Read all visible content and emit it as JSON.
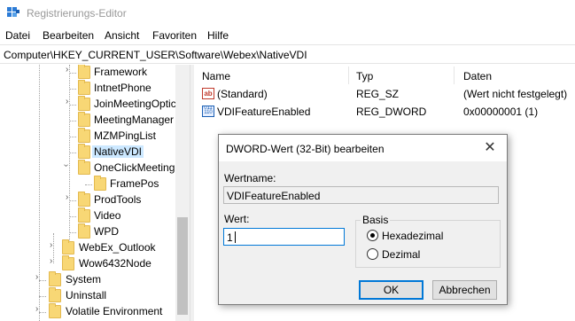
{
  "window": {
    "title": "Registrierungs-Editor"
  },
  "menu": [
    "Datei",
    "Bearbeiten",
    "Ansicht",
    "Favoriten",
    "Hilfe"
  ],
  "address": "Computer\\HKEY_CURRENT_USER\\Software\\Webex\\NativeVDI",
  "tree": {
    "items": [
      {
        "label": "Framework"
      },
      {
        "label": "IntnetPhone"
      },
      {
        "label": "JoinMeetingOptic"
      },
      {
        "label": "MeetingManager"
      },
      {
        "label": "MZMPingList"
      },
      {
        "label": "NativeVDI"
      },
      {
        "label": "OneClickMeeting"
      },
      {
        "label": "FramePos"
      },
      {
        "label": "ProdTools"
      },
      {
        "label": "Video"
      },
      {
        "label": "WPD"
      },
      {
        "label": "WebEx_Outlook"
      },
      {
        "label": "Wow6432Node"
      },
      {
        "label": "System"
      },
      {
        "label": "Uninstall"
      },
      {
        "label": "Volatile Environment"
      }
    ]
  },
  "list": {
    "columns": [
      "Name",
      "Typ",
      "Daten"
    ],
    "rows": [
      {
        "icon": "ab-string-icon",
        "name": "(Standard)",
        "type": "REG_SZ",
        "data": "(Wert nicht festgelegt)"
      },
      {
        "icon": "binary-dword-icon",
        "name": "VDIFeatureEnabled",
        "type": "REG_DWORD",
        "data": "0x00000001 (1)"
      }
    ]
  },
  "dialog": {
    "title": "DWORD-Wert (32-Bit) bearbeiten",
    "close_glyph": "✕",
    "name_label": "Wertname:",
    "name_value": "VDIFeatureEnabled",
    "value_label": "Wert:",
    "value": "1",
    "base_label": "Basis",
    "radio_hex": "Hexadezimal",
    "radio_dec": "Dezimal",
    "selected_base": "Hexadezimal",
    "ok_label": "OK",
    "cancel_label": "Abbrechen"
  }
}
